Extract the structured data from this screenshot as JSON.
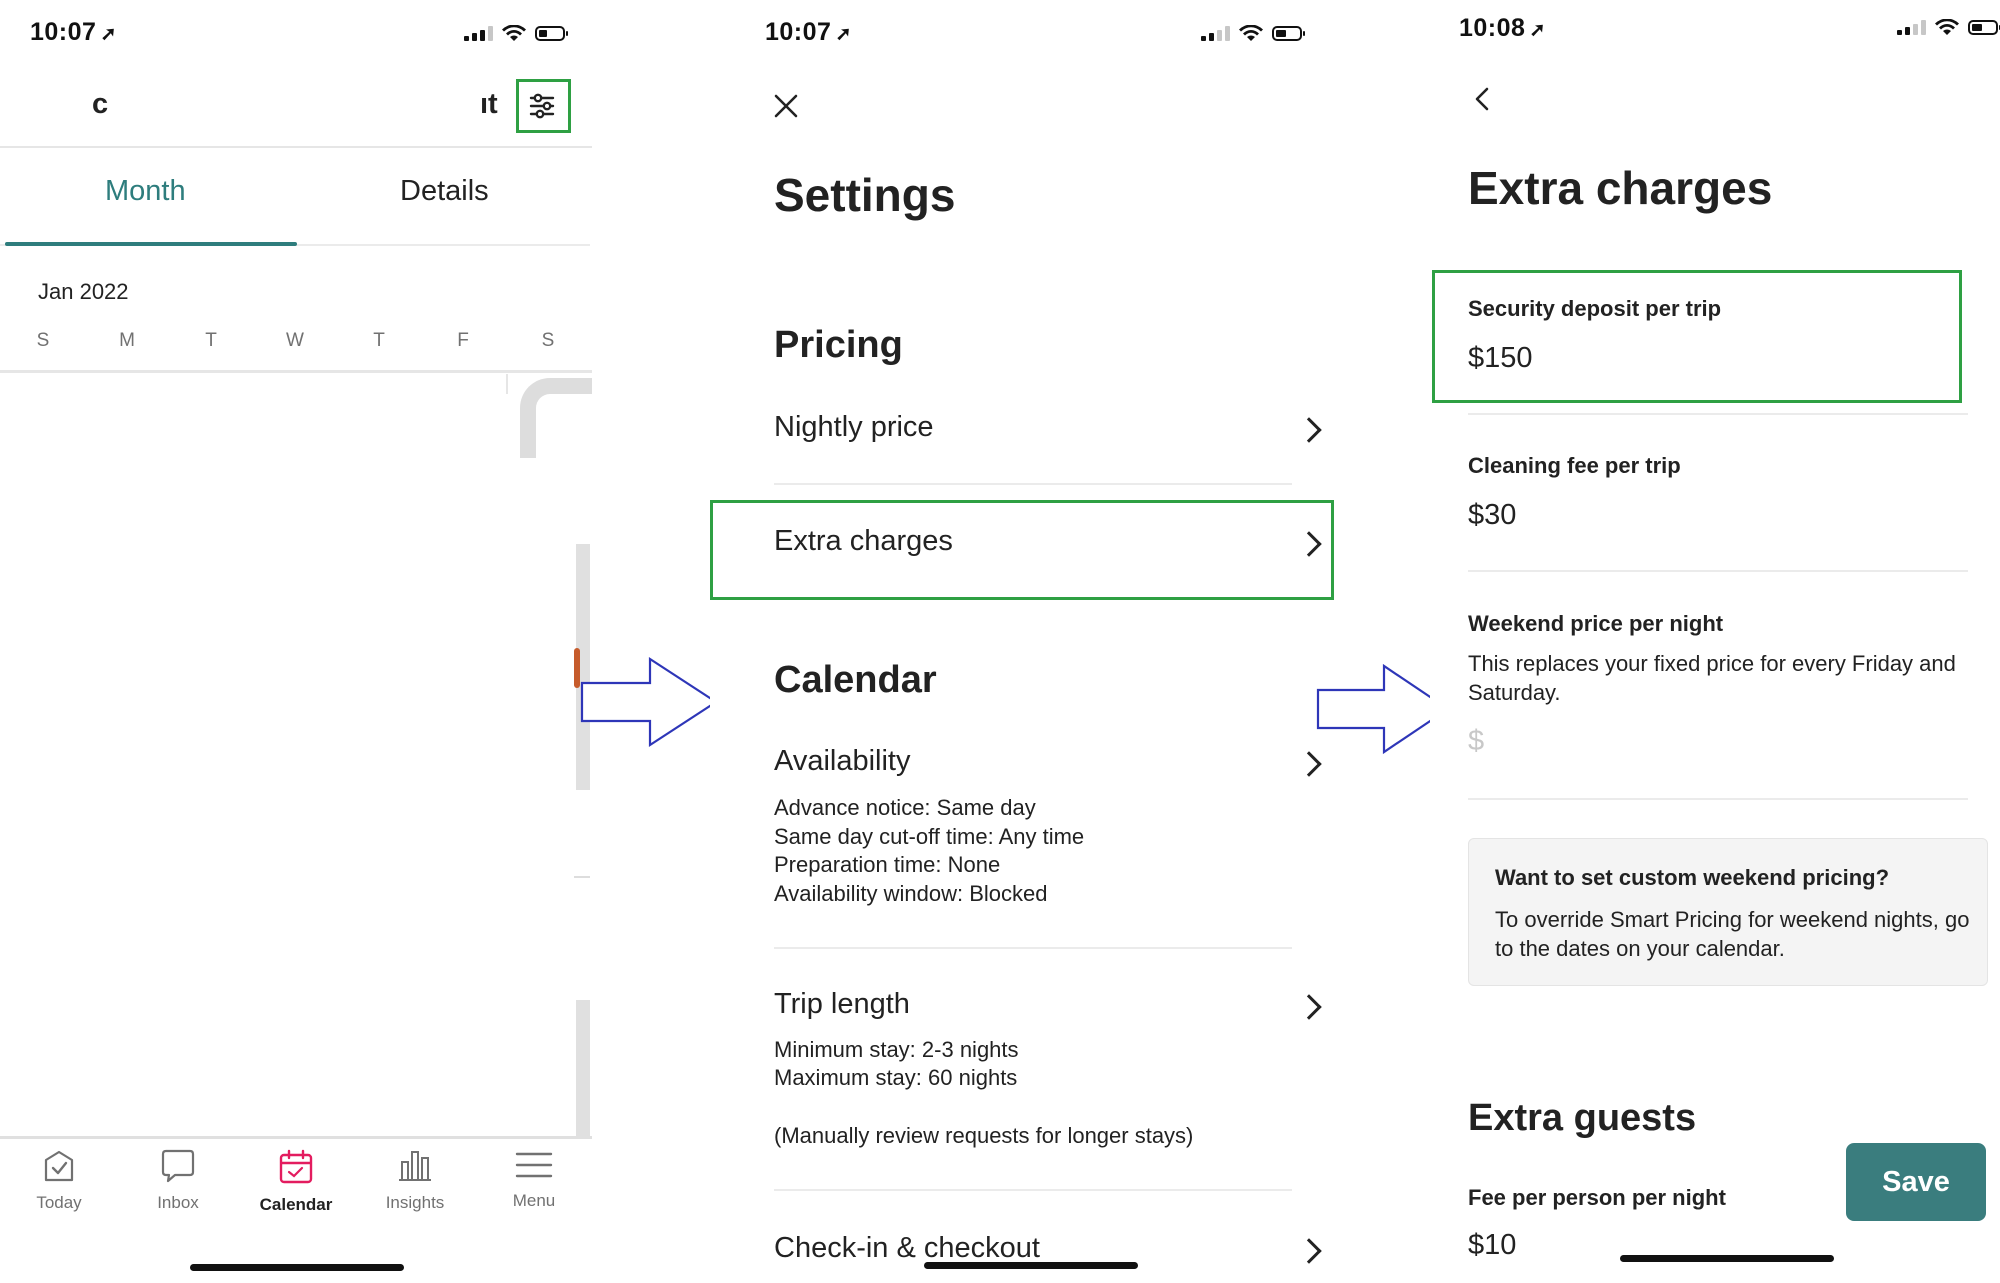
{
  "screen1": {
    "time": "10:07",
    "header_left_fragment": "c",
    "header_right_fragment": "ıt",
    "tabs": [
      {
        "label": "Month"
      },
      {
        "label": "Details"
      }
    ],
    "month_label": "Jan 2022",
    "weekdays": [
      "S",
      "M",
      "T",
      "W",
      "T",
      "F",
      "S"
    ],
    "bottom_nav": [
      {
        "label": "Today",
        "icon": "today-check-icon"
      },
      {
        "label": "Inbox",
        "icon": "chat-bubble-icon"
      },
      {
        "label": "Calendar",
        "icon": "calendar-icon"
      },
      {
        "label": "Insights",
        "icon": "bar-chart-icon"
      },
      {
        "label": "Menu",
        "icon": "hamburger-menu-icon"
      }
    ],
    "active_color": "#E31C5F",
    "accent_color": "#2E7D7D"
  },
  "screen2": {
    "time": "10:07",
    "title": "Settings",
    "sections": {
      "pricing": "Pricing",
      "calendar": "Calendar"
    },
    "rows": {
      "nightly_price": "Nightly price",
      "extra_charges": "Extra charges",
      "availability": "Availability",
      "availability_details": [
        "Advance notice: Same day",
        "Same day cut-off time: Any time",
        "Preparation time: None",
        "Availability window: Blocked"
      ],
      "trip_length": "Trip length",
      "trip_length_details": [
        "Minimum stay: 2-3 nights",
        "Maximum stay: 60 nights"
      ],
      "trip_length_note": "(Manually review requests for longer stays)",
      "checkin": "Check-in & checkout"
    }
  },
  "screen3": {
    "time": "10:08",
    "title": "Extra charges",
    "security_deposit": {
      "label": "Security deposit per trip",
      "value": "$150"
    },
    "cleaning_fee": {
      "label": "Cleaning fee per trip",
      "value": "$30"
    },
    "weekend_price": {
      "label": "Weekend price per night",
      "description": "This replaces your fixed price for every Friday and Saturday.",
      "placeholder": "$"
    },
    "note": {
      "title": "Want to set custom weekend pricing?",
      "body": "To override Smart Pricing for weekend nights, go to the dates on your calendar."
    },
    "extra_guests": {
      "heading": "Extra guests",
      "label": "Fee per person per night",
      "value": "$10"
    },
    "save_label": "Save",
    "save_color": "#3A7D7E"
  },
  "colors": {
    "highlight": "#2EA043",
    "arrow": "#2E36B8"
  }
}
